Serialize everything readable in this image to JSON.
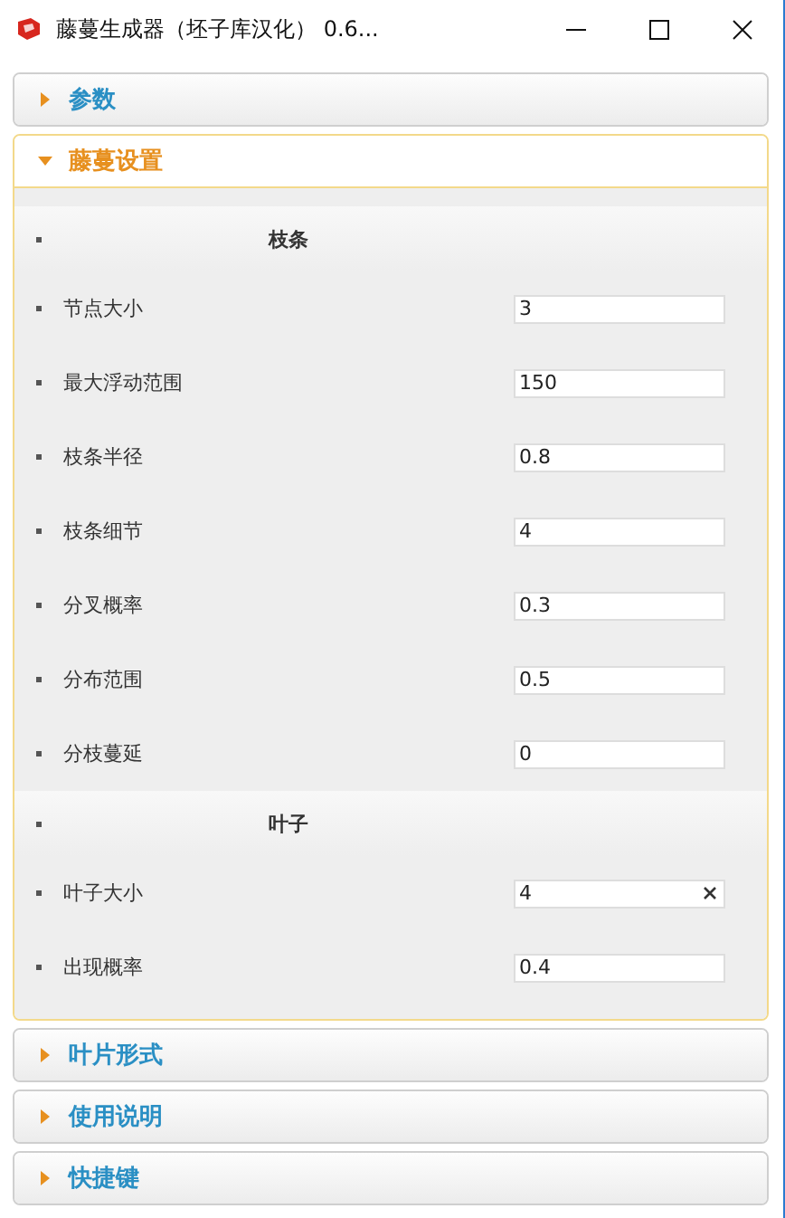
{
  "window": {
    "title": "藤蔓生成器（坯子库汉化） 0.6..."
  },
  "panels": [
    {
      "title": "参数",
      "expanded": false
    },
    {
      "title": "藤蔓设置",
      "expanded": true,
      "items": [
        {
          "kind": "heading",
          "label": "枝条"
        },
        {
          "kind": "field",
          "label": "节点大小",
          "value": "3",
          "clearable": false
        },
        {
          "kind": "field",
          "label": "最大浮动范围",
          "value": "150",
          "clearable": false
        },
        {
          "kind": "field",
          "label": "枝条半径",
          "value": "0.8",
          "clearable": false
        },
        {
          "kind": "field",
          "label": "枝条细节",
          "value": "4",
          "clearable": false
        },
        {
          "kind": "field",
          "label": "分叉概率",
          "value": "0.3",
          "clearable": false
        },
        {
          "kind": "field",
          "label": "分布范围",
          "value": "0.5",
          "clearable": false
        },
        {
          "kind": "field",
          "label": "分枝蔓延",
          "value": "0",
          "clearable": false
        },
        {
          "kind": "heading",
          "label": "叶子"
        },
        {
          "kind": "field",
          "label": "叶子大小",
          "value": "4",
          "clearable": true
        },
        {
          "kind": "field",
          "label": "出现概率",
          "value": "0.4",
          "clearable": false
        }
      ]
    },
    {
      "title": "叶片形式",
      "expanded": false
    },
    {
      "title": "使用说明",
      "expanded": false
    },
    {
      "title": "快捷键",
      "expanded": false
    }
  ]
}
